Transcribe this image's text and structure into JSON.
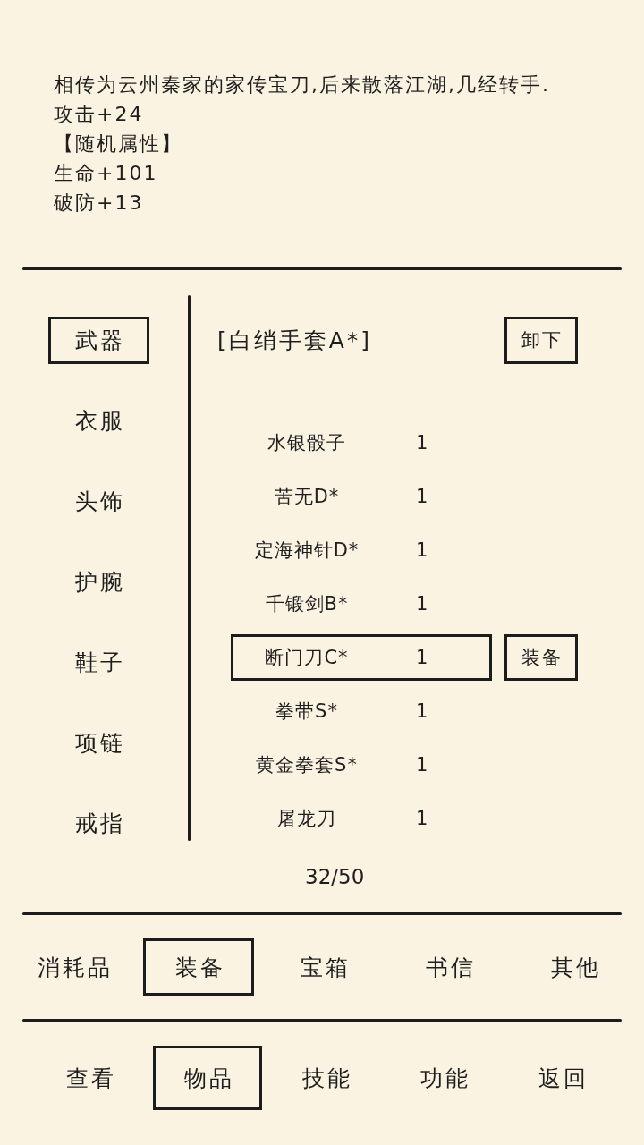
{
  "description": [
    "相传为云州秦家的家传宝刀,后来散落江湖,几经转手.",
    "攻击+24",
    "【随机属性】",
    "生命+101",
    "破防+13"
  ],
  "slots": [
    {
      "label": "武器",
      "selected": true
    },
    {
      "label": "衣服",
      "selected": false
    },
    {
      "label": "头饰",
      "selected": false
    },
    {
      "label": "护腕",
      "selected": false
    },
    {
      "label": "鞋子",
      "selected": false
    },
    {
      "label": "项链",
      "selected": false
    },
    {
      "label": "戒指",
      "selected": false
    }
  ],
  "equipped": {
    "name": "[白绡手套A*]",
    "button": "卸下"
  },
  "items": [
    {
      "name": "水银骰子",
      "count": "1",
      "selected": false
    },
    {
      "name": "苦无D*",
      "count": "1",
      "selected": false
    },
    {
      "name": "定海神针D*",
      "count": "1",
      "selected": false
    },
    {
      "name": "千锻剑B*",
      "count": "1",
      "selected": false
    },
    {
      "name": "断门刀C*",
      "count": "1",
      "selected": true
    },
    {
      "name": "拳带S*",
      "count": "1",
      "selected": false
    },
    {
      "name": "黄金拳套S*",
      "count": "1",
      "selected": false
    },
    {
      "name": "屠龙刀",
      "count": "1",
      "selected": false
    }
  ],
  "equip_button": "装备",
  "capacity": "32/50",
  "categories": [
    {
      "label": "消耗品",
      "selected": false
    },
    {
      "label": "装备",
      "selected": true
    },
    {
      "label": "宝箱",
      "selected": false
    },
    {
      "label": "书信",
      "selected": false
    },
    {
      "label": "其他",
      "selected": false
    }
  ],
  "nav": [
    {
      "label": "查看",
      "selected": false
    },
    {
      "label": "物品",
      "selected": true
    },
    {
      "label": "技能",
      "selected": false
    },
    {
      "label": "功能",
      "selected": false
    },
    {
      "label": "返回",
      "selected": false
    }
  ]
}
